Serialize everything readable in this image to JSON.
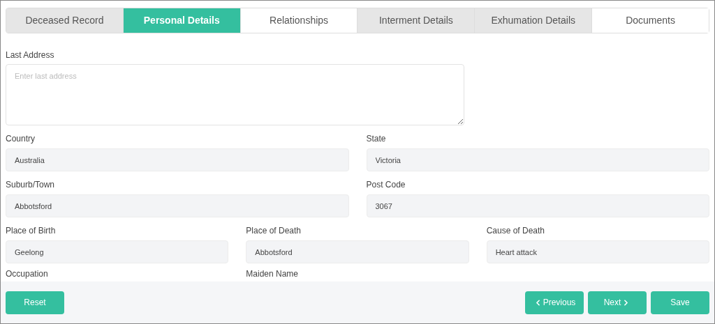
{
  "tabs": [
    {
      "label": "Deceased Record",
      "selected": false,
      "disabled": true
    },
    {
      "label": "Personal Details",
      "selected": true,
      "disabled": false
    },
    {
      "label": "Relationships",
      "selected": false,
      "disabled": false
    },
    {
      "label": "Interment Details",
      "selected": false,
      "disabled": true
    },
    {
      "label": "Exhumation Details",
      "selected": false,
      "disabled": true
    },
    {
      "label": "Documents",
      "selected": false,
      "disabled": false
    }
  ],
  "last_address": {
    "label": "Last Address",
    "placeholder": "Enter last address"
  },
  "rows": [
    [
      {
        "label": "Country",
        "value": "Australia"
      },
      {
        "label": "State",
        "value": "Victoria"
      }
    ],
    [
      {
        "label": "Suburb/Town",
        "value": "Abbotsford"
      },
      {
        "label": "Post Code",
        "value": "3067"
      }
    ],
    [
      {
        "label": "Place of Birth",
        "value": "Geelong"
      },
      {
        "label": "Place of Death",
        "value": "Abbotsford"
      },
      {
        "label": "Cause of Death",
        "value": "Heart attack"
      }
    ]
  ],
  "next_labels": [
    "Occupation",
    "Maiden Name"
  ],
  "footer": {
    "reset": "Reset",
    "previous": "Previous",
    "next": "Next",
    "save": "Save"
  }
}
